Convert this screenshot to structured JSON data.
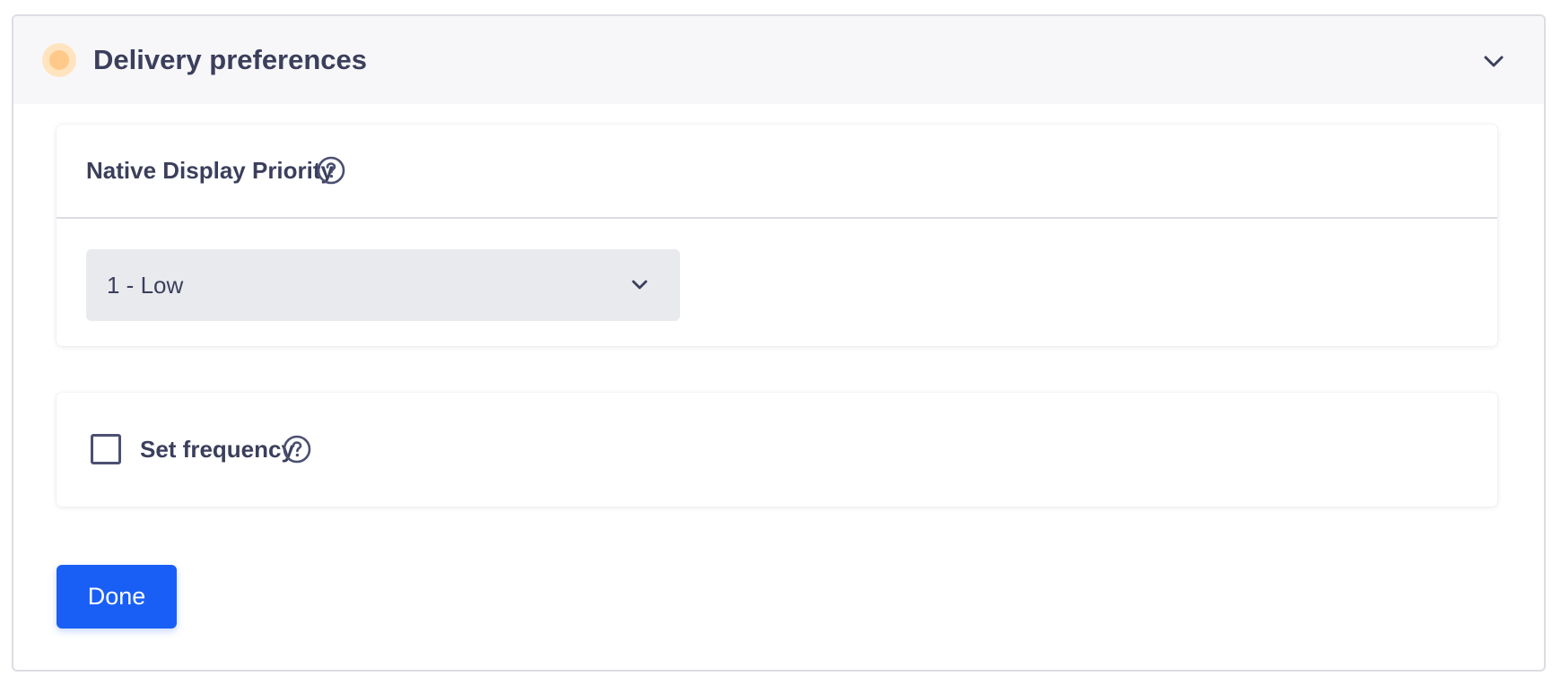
{
  "section": {
    "title": "Delivery preferences",
    "status_color": "#ffc98a",
    "expand_icon": "chevron-up-icon"
  },
  "priority_card": {
    "title": "Native Display Priority",
    "help_icon": "question-circle-icon",
    "select": {
      "value": "1 - Low",
      "icon": "chevron-down-icon"
    }
  },
  "frequency_card": {
    "label": "Set frequency",
    "checked": false,
    "help_icon": "question-circle-icon"
  },
  "actions": {
    "done_label": "Done",
    "accent_color": "#1a5ff5"
  }
}
